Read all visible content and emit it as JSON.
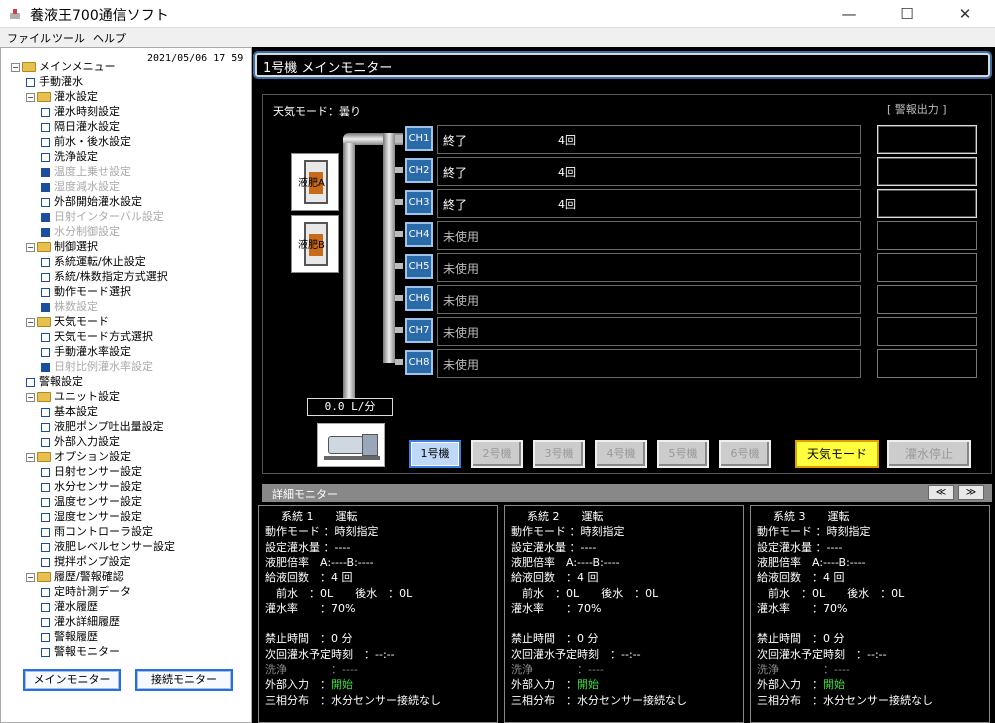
{
  "window": {
    "title": "養液王700通信ソフト",
    "minimize": "—",
    "maximize": "☐",
    "close": "✕"
  },
  "menu": [
    "ファイル",
    "ツール",
    "ヘルプ"
  ],
  "sidebar": {
    "datetime": "2021/05/06 17 59",
    "tree": [
      {
        "label": "メインメニュー",
        "level": 0,
        "kind": "folder"
      },
      {
        "label": "手動灌水",
        "level": 1,
        "kind": "item"
      },
      {
        "label": "灌水設定",
        "level": 1,
        "kind": "folder"
      },
      {
        "label": "灌水時刻設定",
        "level": 2,
        "kind": "item"
      },
      {
        "label": "隔日灌水設定",
        "level": 2,
        "kind": "item"
      },
      {
        "label": "前水・後水設定",
        "level": 2,
        "kind": "item"
      },
      {
        "label": "洗浄設定",
        "level": 2,
        "kind": "item"
      },
      {
        "label": "温度上乗せ設定",
        "level": 2,
        "kind": "disabled"
      },
      {
        "label": "湿度減水設定",
        "level": 2,
        "kind": "disabled"
      },
      {
        "label": "外部開始灌水設定",
        "level": 2,
        "kind": "item"
      },
      {
        "label": "日射インターバル設定",
        "level": 2,
        "kind": "disabled"
      },
      {
        "label": "水分制御設定",
        "level": 2,
        "kind": "disabled"
      },
      {
        "label": "制御選択",
        "level": 1,
        "kind": "folder"
      },
      {
        "label": "系統運転/休止設定",
        "level": 2,
        "kind": "item"
      },
      {
        "label": "系統/株数指定方式選択",
        "level": 2,
        "kind": "item"
      },
      {
        "label": "動作モード選択",
        "level": 2,
        "kind": "item"
      },
      {
        "label": "株数設定",
        "level": 2,
        "kind": "disabled"
      },
      {
        "label": "天気モード",
        "level": 1,
        "kind": "folder"
      },
      {
        "label": "天気モード方式選択",
        "level": 2,
        "kind": "item"
      },
      {
        "label": "手動灌水率設定",
        "level": 2,
        "kind": "item"
      },
      {
        "label": "日射比例灌水率設定",
        "level": 2,
        "kind": "disabled"
      },
      {
        "label": "警報設定",
        "level": 1,
        "kind": "item"
      },
      {
        "label": "ユニット設定",
        "level": 1,
        "kind": "folder"
      },
      {
        "label": "基本設定",
        "level": 2,
        "kind": "item"
      },
      {
        "label": "液肥ポンプ吐出量設定",
        "level": 2,
        "kind": "item"
      },
      {
        "label": "外部入力設定",
        "level": 2,
        "kind": "item"
      },
      {
        "label": "オプション設定",
        "level": 1,
        "kind": "folder"
      },
      {
        "label": "日射センサー設定",
        "level": 2,
        "kind": "item"
      },
      {
        "label": "水分センサー設定",
        "level": 2,
        "kind": "item"
      },
      {
        "label": "温度センサー設定",
        "level": 2,
        "kind": "item"
      },
      {
        "label": "湿度センサー設定",
        "level": 2,
        "kind": "item"
      },
      {
        "label": "雨コントローラ設定",
        "level": 2,
        "kind": "item"
      },
      {
        "label": "液肥レベルセンサー設定",
        "level": 2,
        "kind": "item"
      },
      {
        "label": "撹拌ポンプ設定",
        "level": 2,
        "kind": "item"
      },
      {
        "label": "履歴/警報確認",
        "level": 1,
        "kind": "folder"
      },
      {
        "label": "定時計測データ",
        "level": 2,
        "kind": "item"
      },
      {
        "label": "灌水履歴",
        "level": 2,
        "kind": "item"
      },
      {
        "label": "灌水詳細履歴",
        "level": 2,
        "kind": "item"
      },
      {
        "label": "警報履歴",
        "level": 2,
        "kind": "item"
      },
      {
        "label": "警報モニター",
        "level": 2,
        "kind": "item"
      }
    ],
    "main_monitor_btn": "メインモニター",
    "conn_monitor_btn": "接続モニター"
  },
  "main": {
    "title": "1号機 メインモニター",
    "weather_mode": "天気モード：曇り",
    "alarm_output": "[ 警報出力 ]",
    "fert_a": "液肥A",
    "fert_b": "液肥B",
    "channels": [
      {
        "ch": "CH1",
        "status": "終了",
        "count": "4回",
        "used": true
      },
      {
        "ch": "CH2",
        "status": "終了",
        "count": "4回",
        "used": true
      },
      {
        "ch": "CH3",
        "status": "終了",
        "count": "4回",
        "used": true
      },
      {
        "ch": "CH4",
        "status": "未使用",
        "count": "",
        "used": false
      },
      {
        "ch": "CH5",
        "status": "未使用",
        "count": "",
        "used": false
      },
      {
        "ch": "CH6",
        "status": "未使用",
        "count": "",
        "used": false
      },
      {
        "ch": "CH7",
        "status": "未使用",
        "count": "",
        "used": false
      },
      {
        "ch": "CH8",
        "status": "未使用",
        "count": "",
        "used": false
      }
    ],
    "flow": "0.0 L/分",
    "units": [
      "1号機",
      "2号機",
      "3号機",
      "4号機",
      "5号機",
      "6号機"
    ],
    "weather_btn": "天気モード",
    "stop_btn": "灌水停止"
  },
  "detail": {
    "title": "詳細モニター",
    "prev": "≪",
    "next": "≫",
    "systems": [
      {
        "head": "系統 1　　運転",
        "mode": "動作モード ：時刻指定",
        "set": "設定灌水量 ：----",
        "ratio": "液肥倍率　A:----B:----",
        "count": "給液回数　：4 回",
        "prepost": "　前水　：0L　　後水　：0L",
        "rate": "灌水率　　：70%",
        "ban": "禁止時間　：0 分",
        "next": "次回灌水予定時刻　：--:--",
        "wash_label": "洗浄",
        "wash_val": "：----",
        "ext_label": "外部入力　：",
        "ext_val": "開始",
        "phase": "三相分布　：水分センサー接続なし"
      },
      {
        "head": "系統 2　　運転",
        "mode": "動作モード ：時刻指定",
        "set": "設定灌水量 ：----",
        "ratio": "液肥倍率　A:----B:----",
        "count": "給液回数　：4 回",
        "prepost": "　前水　：0L　　後水　：0L",
        "rate": "灌水率　　：70%",
        "ban": "禁止時間　：0 分",
        "next": "次回灌水予定時刻　：--:--",
        "wash_label": "洗浄",
        "wash_val": "：----",
        "ext_label": "外部入力　：",
        "ext_val": "開始",
        "phase": "三相分布　：水分センサー接続なし"
      },
      {
        "head": "系統 3　　運転",
        "mode": "動作モード ：時刻指定",
        "set": "設定灌水量 ：----",
        "ratio": "液肥倍率　A:----B:----",
        "count": "給液回数　：4 回",
        "prepost": "　前水　：0L　　後水　：0L",
        "rate": "灌水率　　：70%",
        "ban": "禁止時間　：0 分",
        "next": "次回灌水予定時刻　：--:--",
        "wash_label": "洗浄",
        "wash_val": "：----",
        "ext_label": "外部入力　：",
        "ext_val": "開始",
        "phase": "三相分布　：水分センサー接続なし"
      }
    ]
  }
}
